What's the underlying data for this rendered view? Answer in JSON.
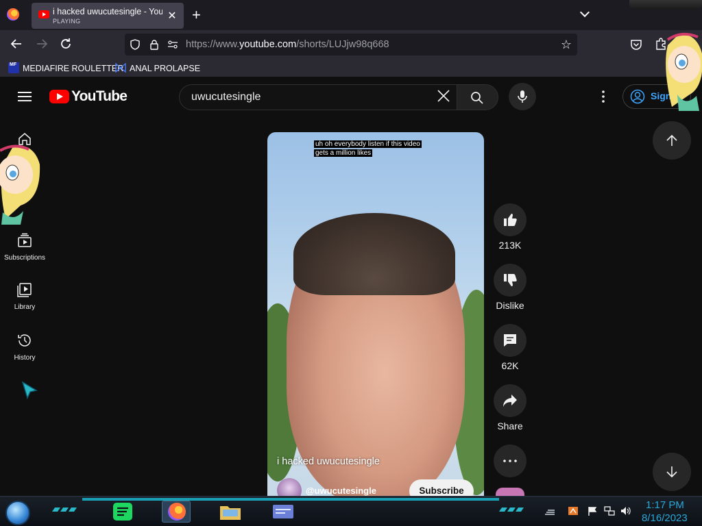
{
  "browser": {
    "tab": {
      "title": "i hacked uwucutesingle - YouTube",
      "status": "PLAYING",
      "close_glyph": "✕"
    },
    "new_tab_glyph": "+",
    "url": {
      "prefix": "https://www.",
      "host": "youtube.com",
      "path": "/shorts/LUJjw98q668"
    },
    "bookmarks": [
      {
        "label": "MEDIAFIRE ROULETTER",
        "icon": "mediafire-icon"
      },
      {
        "label": "ANAL PROLAPSE",
        "icon": "bookmark-icon"
      }
    ]
  },
  "youtube": {
    "logo_text": "YouTube",
    "search": {
      "value": "uwucutesingle"
    },
    "signin_label": "Sign in",
    "sidebar": [
      {
        "label": "",
        "icon": "home-icon"
      },
      {
        "label": "Subscriptions",
        "icon": "subscriptions-icon"
      },
      {
        "label": "Library",
        "icon": "library-icon"
      },
      {
        "label": "History",
        "icon": "history-icon"
      }
    ],
    "short": {
      "caption_line1": "uh oh everybody listen if this video",
      "caption_line2": "gets a million likes",
      "title": "i hacked uwucutesingle",
      "channel": "@uwucutesingle",
      "subscribe_label": "Subscribe"
    },
    "actions": {
      "like_count": "213K",
      "dislike_label": "Dislike",
      "comment_count": "62K",
      "share_label": "Share"
    }
  },
  "taskbar": {
    "time": "1:17 PM",
    "date": "8/16/2023"
  },
  "colors": {
    "youtube_red": "#ff0000",
    "accent_blue": "#3ea6ff",
    "taskbar_clock": "#28a8d8"
  }
}
